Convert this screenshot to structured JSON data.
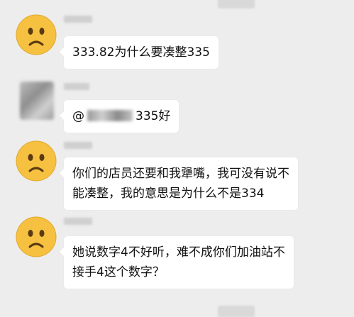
{
  "messages": [
    {
      "id": "m1",
      "avatar": "worried-face-icon",
      "sender_name": "",
      "text": "333.82为什么要凑整335"
    },
    {
      "id": "m2",
      "avatar": "blurred-profile-photo",
      "sender_name": "",
      "mention_prefix": "@",
      "text": "335好"
    },
    {
      "id": "m3",
      "avatar": "worried-face-icon",
      "sender_name": "",
      "lines": [
        "你们的店员还要和我犟嘴，我可没有说不",
        "能凑整，我的意思是为什么不是334"
      ]
    },
    {
      "id": "m4",
      "avatar": "worried-face-icon",
      "sender_name": "",
      "lines": [
        "她说数字4不好听，难不成你们加油站不",
        "接手4这个数字？"
      ]
    }
  ],
  "colors": {
    "background": "#ededed",
    "bubble": "#ffffff",
    "emoji_face": "#f6c141",
    "emoji_features": "#5a3a12"
  }
}
